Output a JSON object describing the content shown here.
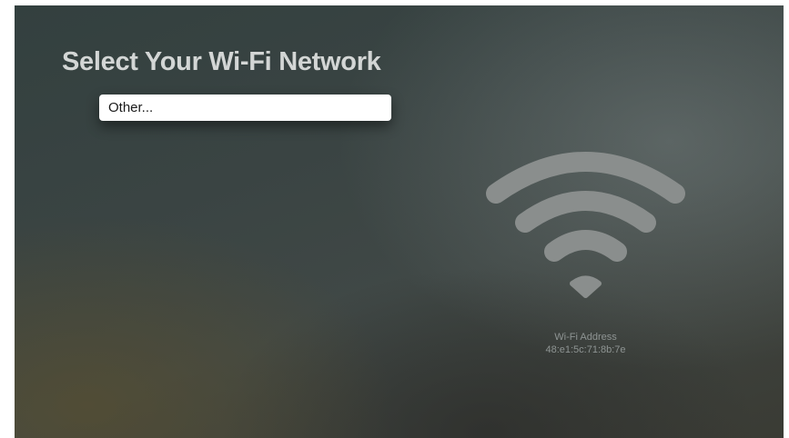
{
  "screen": {
    "title": "Select Your Wi-Fi Network",
    "networks": [
      {
        "label": "Other...",
        "selected": true
      }
    ]
  },
  "wifi": {
    "icon": "wifi-icon",
    "address_label": "Wi-Fi Address",
    "address_value": "48:e1:5c:71:8b:7e"
  },
  "colors": {
    "title": "#d3d6d5",
    "selected_row_bg": "#ffffff",
    "wifi_icon": "#8a8e8d",
    "info_text": "#8e9493"
  }
}
